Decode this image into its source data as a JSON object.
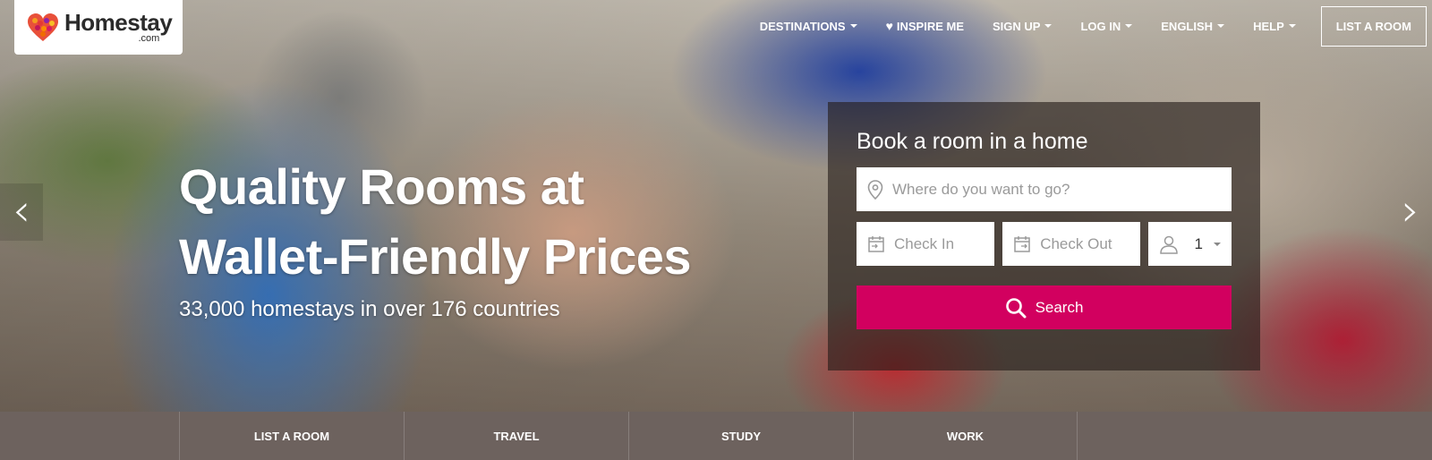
{
  "logo": {
    "name": "Homestay",
    "suffix": ".com"
  },
  "nav": {
    "destinations": "DESTINATIONS",
    "inspire": "INSPIRE ME",
    "signup": "SIGN UP",
    "login": "LOG IN",
    "language": "ENGLISH",
    "help": "HELP",
    "list_room": "LIST A ROOM"
  },
  "hero": {
    "headline_line1": "Quality Rooms at",
    "headline_line2": "Wallet-Friendly Prices",
    "subheadline": "33,000 homestays in over 176 countries"
  },
  "booking": {
    "title": "Book a room in a home",
    "where_placeholder": "Where do you want to go?",
    "checkin_placeholder": "Check In",
    "checkout_placeholder": "Check Out",
    "guests_value": "1",
    "search_label": "Search"
  },
  "bottom_bar": {
    "items": [
      {
        "label": "LIST A ROOM"
      },
      {
        "label": "TRAVEL"
      },
      {
        "label": "STUDY"
      },
      {
        "label": "WORK"
      }
    ]
  },
  "colors": {
    "accent": "#d2005f",
    "bottom_bar": "#6d625e",
    "booking_overlay": "rgba(35,28,25,0.62)"
  },
  "icons": [
    "heart-logo-icon",
    "heart-icon",
    "caret-down-icon",
    "map-pin-icon",
    "calendar-checkin-icon",
    "calendar-checkout-icon",
    "person-icon",
    "search-icon",
    "chevron-left-icon",
    "chevron-right-icon"
  ]
}
